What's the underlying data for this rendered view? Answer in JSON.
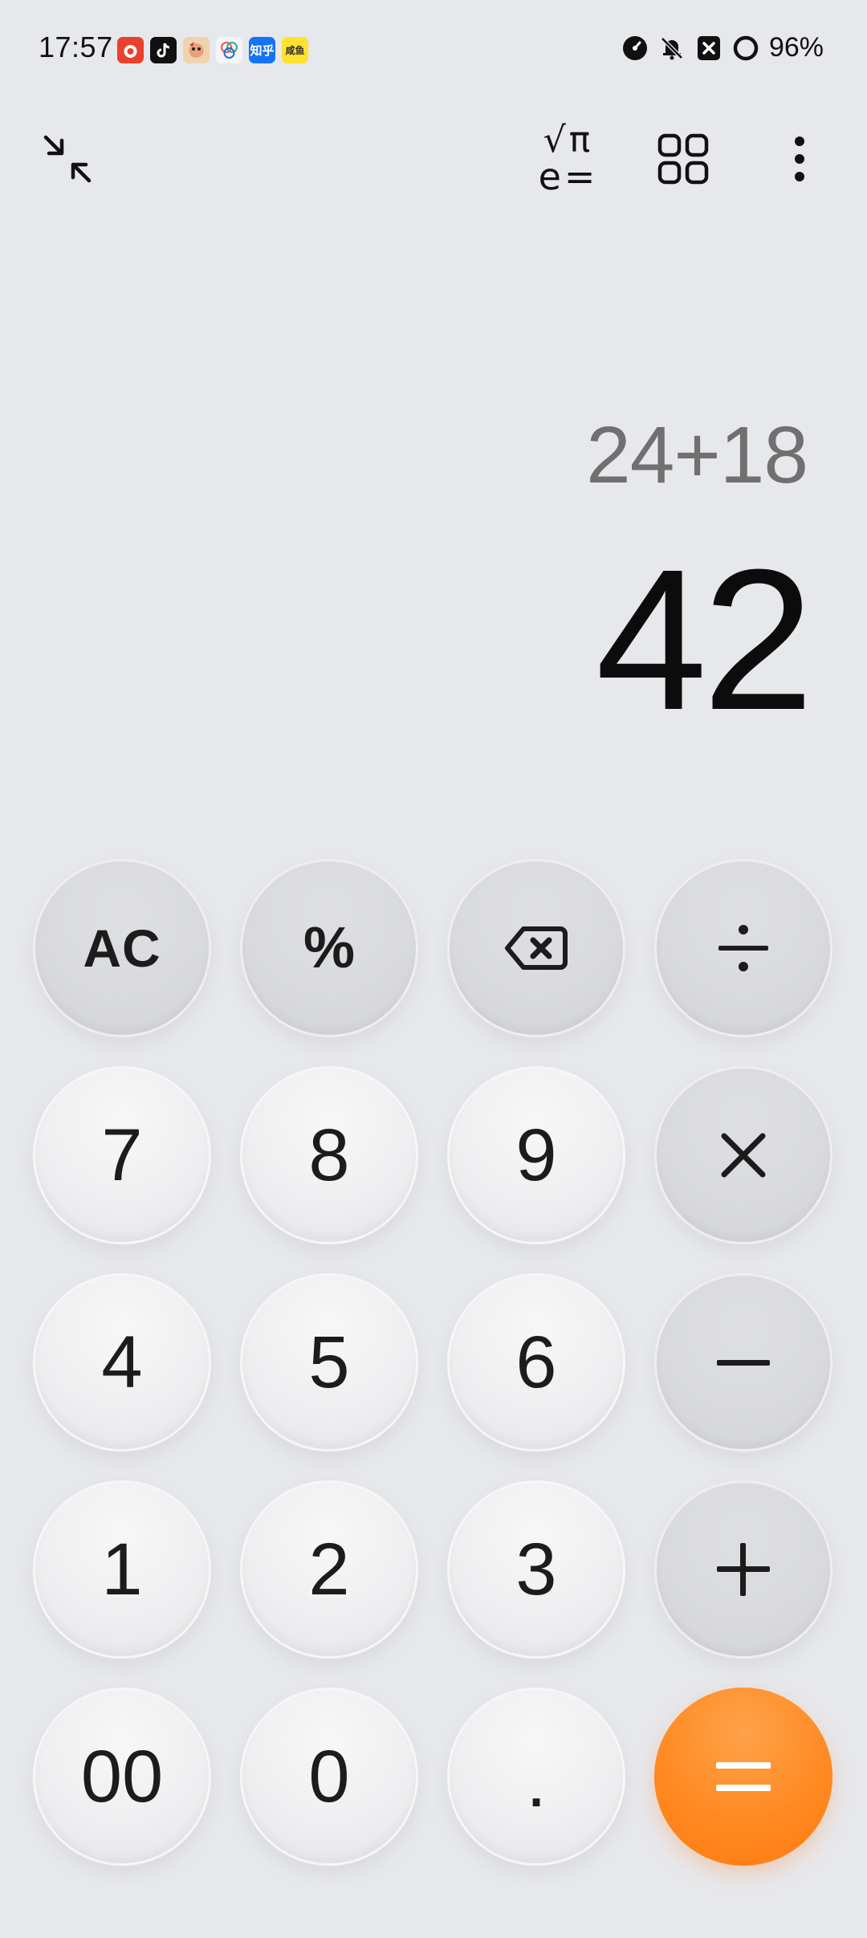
{
  "status_bar": {
    "time": "17:57",
    "battery": "96%",
    "notification_apps": [
      "pinduoduo-app-icon",
      "tiktok-app-icon",
      "game-app-icon",
      "photos-app-icon",
      "zhihu-app-icon",
      "xianyu-app-icon"
    ],
    "zhihu_label": "知乎",
    "xianyu_label": "咸鱼",
    "system_icons": [
      "speedometer-icon",
      "bell-off-icon",
      "close-box-icon",
      "battery-ring-icon"
    ]
  },
  "toolbar": {
    "collapse_icon": "collapse-icon",
    "scientific_label_top": "√π",
    "scientific_label_bottom": "e=",
    "grid_icon": "grid-icon",
    "more_icon": "more-vertical-icon"
  },
  "display": {
    "expression": "24+18",
    "result": "42"
  },
  "keypad": {
    "rows": [
      [
        "AC",
        "%",
        "⌫",
        "÷"
      ],
      [
        "7",
        "8",
        "9",
        "×"
      ],
      [
        "4",
        "5",
        "6",
        "−"
      ],
      [
        "1",
        "2",
        "3",
        "+"
      ],
      [
        "00",
        "0",
        ".",
        "="
      ]
    ],
    "colors": {
      "equals": "#ff8a22",
      "digit_bg": "#efeff1",
      "func_bg": "#d9dadd"
    }
  }
}
